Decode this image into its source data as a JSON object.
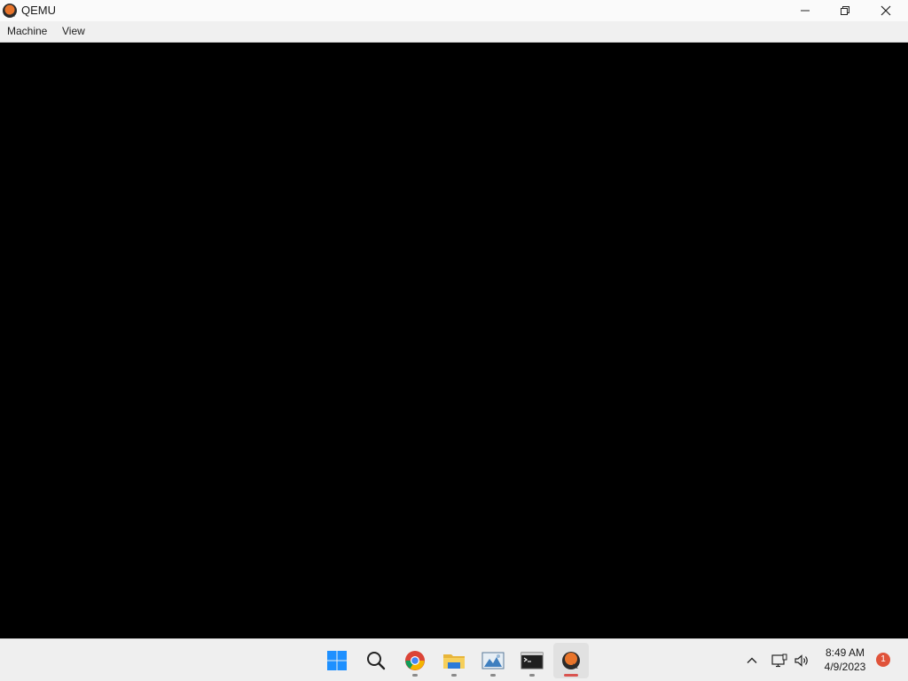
{
  "window": {
    "title": "QEMU",
    "app_icon": "qemu-logo-icon",
    "controls": {
      "minimize": "minimize-icon",
      "restore": "restore-icon",
      "close": "close-icon"
    }
  },
  "menubar": {
    "items": [
      {
        "label": "Machine"
      },
      {
        "label": "View"
      }
    ]
  },
  "display": {
    "background": "#000000",
    "content": ""
  },
  "taskbar": {
    "apps": [
      {
        "name": "start",
        "icon": "windows-start-icon",
        "running": false
      },
      {
        "name": "search",
        "icon": "search-icon",
        "running": false
      },
      {
        "name": "chrome",
        "icon": "chrome-icon",
        "running": true
      },
      {
        "name": "file-explorer",
        "icon": "folder-icon",
        "running": true
      },
      {
        "name": "photos",
        "icon": "image-viewer-icon",
        "running": true
      },
      {
        "name": "terminal",
        "icon": "terminal-icon",
        "running": true
      },
      {
        "name": "qemu",
        "icon": "qemu-logo-icon",
        "running": true,
        "active": true
      }
    ],
    "tray": {
      "icons": [
        "chevron-up-icon",
        "network-icon",
        "speaker-icon"
      ],
      "time": "8:49 AM",
      "date": "4/9/2023",
      "notification_count": "1"
    },
    "accent": "#d9534f"
  }
}
